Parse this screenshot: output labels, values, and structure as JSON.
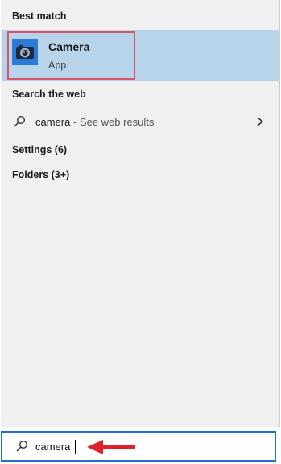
{
  "sections": {
    "best_match": "Best match",
    "search_web": "Search the web",
    "settings": "Settings (6)",
    "folders": "Folders (3+)"
  },
  "best_match_item": {
    "name": "Camera",
    "type": "App",
    "icon": "camera-icon"
  },
  "web_result": {
    "query": "camera",
    "suffix": "See web results",
    "separator": " - "
  },
  "search_box": {
    "value": "camera"
  },
  "colors": {
    "selected_row": "#b8d4ea",
    "highlight_border": "#d9536b",
    "app_icon_bg": "#2d7bd4",
    "search_border": "#1f6fd1",
    "arrow": "#e0202a"
  }
}
